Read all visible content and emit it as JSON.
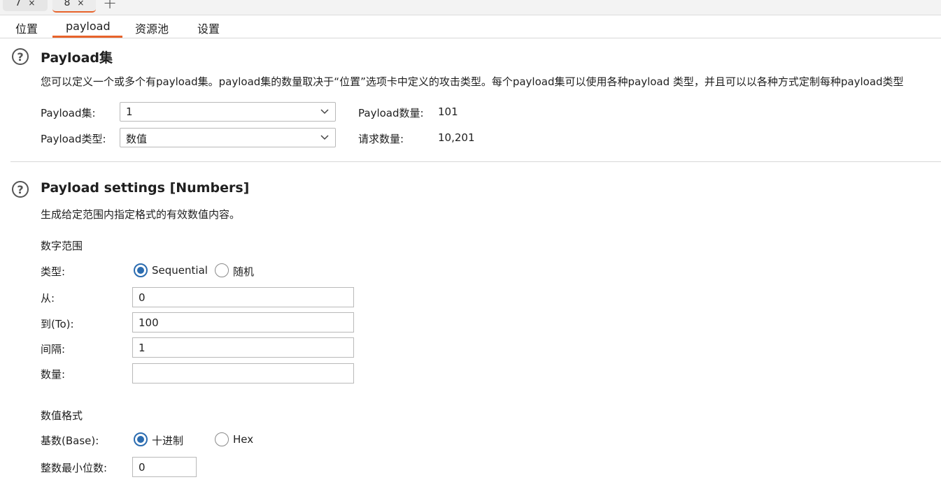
{
  "attack_tabs": [
    {
      "label": "7",
      "close": "×"
    },
    {
      "label": "8",
      "close": "×"
    }
  ],
  "add_tab": "+",
  "subtabs": [
    "位置",
    "payload",
    "资源池",
    "设置"
  ],
  "payload_sets": {
    "title": "Payload集",
    "help": "?",
    "description": "您可以定义一个或多个有payload集。payload集的数量取决于“位置”选项卡中定义的攻击类型。每个payload集可以使用各种payload 类型，并且可以以各种方式定制每种payload类型",
    "set_label": "Payload集:",
    "set_value": "1",
    "type_label": "Payload类型:",
    "type_value": "数值",
    "count_label": "Payload数量:",
    "count_value": "101",
    "requests_label": "请求数量:",
    "requests_value": "10,201"
  },
  "payload_settings": {
    "title": "Payload settings [Numbers]",
    "help": "?",
    "description": "生成给定范围内指定格式的有效数值内容。",
    "range_header": "数字范围",
    "type_label": "类型:",
    "type_options": [
      "Sequential",
      "随机"
    ],
    "type_selected": "Sequential",
    "from_label": "从:",
    "from_value": "0",
    "to_label": "到(To):",
    "to_value": "100",
    "step_label": "间隔:",
    "step_value": "1",
    "howmany_label": "数量:",
    "howmany_value": "",
    "format_header": "数值格式",
    "base_label": "基数(Base):",
    "base_options": [
      "十进制",
      "Hex"
    ],
    "base_selected": "十进制",
    "min_int_label": "整数最小位数:",
    "min_int_value": "0"
  },
  "colors": {
    "accent": "#e8632b",
    "radio_selected": "#2b6cb0"
  }
}
